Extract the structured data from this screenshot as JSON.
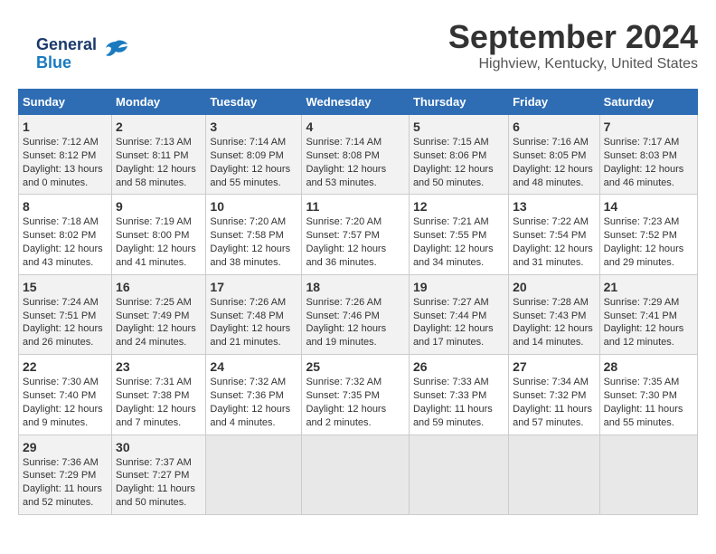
{
  "logo": {
    "line1": "General",
    "line2": "Blue"
  },
  "header": {
    "month": "September 2024",
    "location": "Highview, Kentucky, United States"
  },
  "days_of_week": [
    "Sunday",
    "Monday",
    "Tuesday",
    "Wednesday",
    "Thursday",
    "Friday",
    "Saturday"
  ],
  "weeks": [
    [
      {
        "day": "1",
        "sunrise": "7:12 AM",
        "sunset": "8:12 PM",
        "daylight": "13 hours and 0 minutes."
      },
      {
        "day": "2",
        "sunrise": "7:13 AM",
        "sunset": "8:11 PM",
        "daylight": "12 hours and 58 minutes."
      },
      {
        "day": "3",
        "sunrise": "7:14 AM",
        "sunset": "8:09 PM",
        "daylight": "12 hours and 55 minutes."
      },
      {
        "day": "4",
        "sunrise": "7:14 AM",
        "sunset": "8:08 PM",
        "daylight": "12 hours and 53 minutes."
      },
      {
        "day": "5",
        "sunrise": "7:15 AM",
        "sunset": "8:06 PM",
        "daylight": "12 hours and 50 minutes."
      },
      {
        "day": "6",
        "sunrise": "7:16 AM",
        "sunset": "8:05 PM",
        "daylight": "12 hours and 48 minutes."
      },
      {
        "day": "7",
        "sunrise": "7:17 AM",
        "sunset": "8:03 PM",
        "daylight": "12 hours and 46 minutes."
      }
    ],
    [
      {
        "day": "8",
        "sunrise": "7:18 AM",
        "sunset": "8:02 PM",
        "daylight": "12 hours and 43 minutes."
      },
      {
        "day": "9",
        "sunrise": "7:19 AM",
        "sunset": "8:00 PM",
        "daylight": "12 hours and 41 minutes."
      },
      {
        "day": "10",
        "sunrise": "7:20 AM",
        "sunset": "7:58 PM",
        "daylight": "12 hours and 38 minutes."
      },
      {
        "day": "11",
        "sunrise": "7:20 AM",
        "sunset": "7:57 PM",
        "daylight": "12 hours and 36 minutes."
      },
      {
        "day": "12",
        "sunrise": "7:21 AM",
        "sunset": "7:55 PM",
        "daylight": "12 hours and 34 minutes."
      },
      {
        "day": "13",
        "sunrise": "7:22 AM",
        "sunset": "7:54 PM",
        "daylight": "12 hours and 31 minutes."
      },
      {
        "day": "14",
        "sunrise": "7:23 AM",
        "sunset": "7:52 PM",
        "daylight": "12 hours and 29 minutes."
      }
    ],
    [
      {
        "day": "15",
        "sunrise": "7:24 AM",
        "sunset": "7:51 PM",
        "daylight": "12 hours and 26 minutes."
      },
      {
        "day": "16",
        "sunrise": "7:25 AM",
        "sunset": "7:49 PM",
        "daylight": "12 hours and 24 minutes."
      },
      {
        "day": "17",
        "sunrise": "7:26 AM",
        "sunset": "7:48 PM",
        "daylight": "12 hours and 21 minutes."
      },
      {
        "day": "18",
        "sunrise": "7:26 AM",
        "sunset": "7:46 PM",
        "daylight": "12 hours and 19 minutes."
      },
      {
        "day": "19",
        "sunrise": "7:27 AM",
        "sunset": "7:44 PM",
        "daylight": "12 hours and 17 minutes."
      },
      {
        "day": "20",
        "sunrise": "7:28 AM",
        "sunset": "7:43 PM",
        "daylight": "12 hours and 14 minutes."
      },
      {
        "day": "21",
        "sunrise": "7:29 AM",
        "sunset": "7:41 PM",
        "daylight": "12 hours and 12 minutes."
      }
    ],
    [
      {
        "day": "22",
        "sunrise": "7:30 AM",
        "sunset": "7:40 PM",
        "daylight": "12 hours and 9 minutes."
      },
      {
        "day": "23",
        "sunrise": "7:31 AM",
        "sunset": "7:38 PM",
        "daylight": "12 hours and 7 minutes."
      },
      {
        "day": "24",
        "sunrise": "7:32 AM",
        "sunset": "7:36 PM",
        "daylight": "12 hours and 4 minutes."
      },
      {
        "day": "25",
        "sunrise": "7:32 AM",
        "sunset": "7:35 PM",
        "daylight": "12 hours and 2 minutes."
      },
      {
        "day": "26",
        "sunrise": "7:33 AM",
        "sunset": "7:33 PM",
        "daylight": "11 hours and 59 minutes."
      },
      {
        "day": "27",
        "sunrise": "7:34 AM",
        "sunset": "7:32 PM",
        "daylight": "11 hours and 57 minutes."
      },
      {
        "day": "28",
        "sunrise": "7:35 AM",
        "sunset": "7:30 PM",
        "daylight": "11 hours and 55 minutes."
      }
    ],
    [
      {
        "day": "29",
        "sunrise": "7:36 AM",
        "sunset": "7:29 PM",
        "daylight": "11 hours and 52 minutes."
      },
      {
        "day": "30",
        "sunrise": "7:37 AM",
        "sunset": "7:27 PM",
        "daylight": "11 hours and 50 minutes."
      },
      null,
      null,
      null,
      null,
      null
    ]
  ]
}
